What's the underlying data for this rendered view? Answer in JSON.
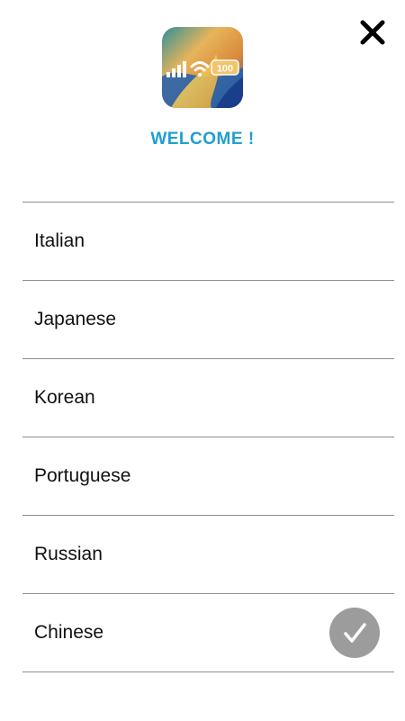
{
  "header": {
    "title": "WELCOME !",
    "close_icon": "close-icon",
    "app_icon": {
      "badge_text": "100",
      "icons": [
        "signal-bars-icon",
        "wifi-icon",
        "battery-icon"
      ]
    }
  },
  "languages": [
    {
      "label": "Italian",
      "selected": false
    },
    {
      "label": "Japanese",
      "selected": false
    },
    {
      "label": "Korean",
      "selected": false
    },
    {
      "label": "Portuguese",
      "selected": false
    },
    {
      "label": "Russian",
      "selected": false
    },
    {
      "label": "Chinese",
      "selected": true
    }
  ],
  "colors": {
    "accent": "#1e9fd0",
    "divider": "#8e8e8e",
    "check_bg": "#9c9c9c",
    "text": "#111111"
  }
}
